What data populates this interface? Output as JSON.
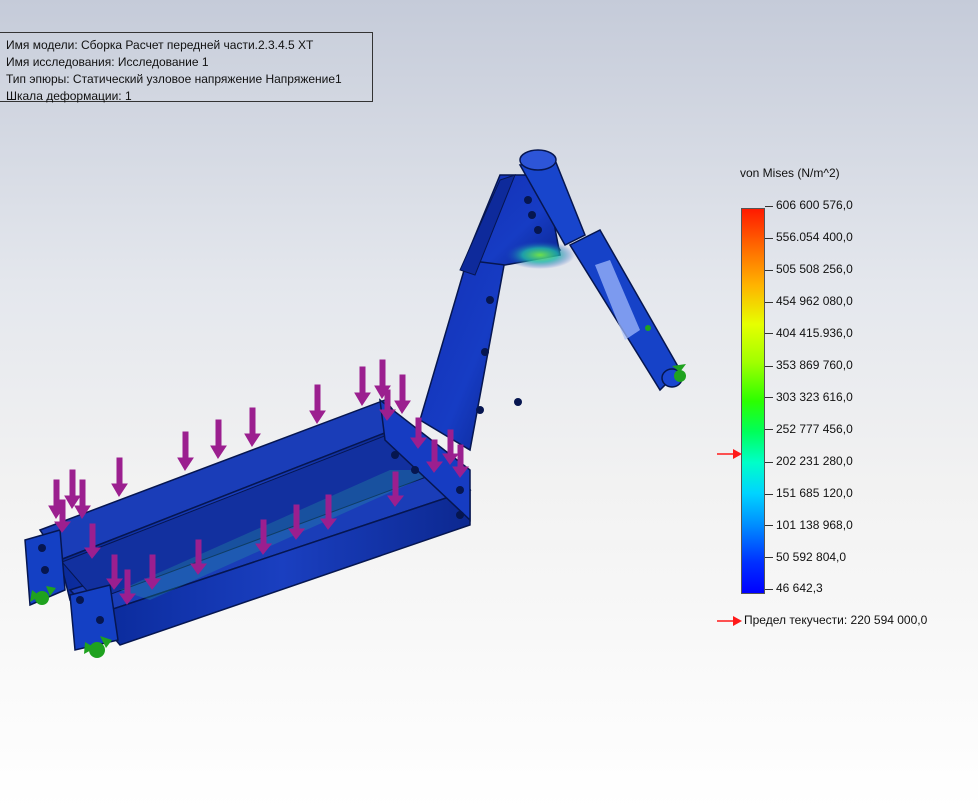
{
  "info": {
    "model_name": "Имя модели: Сборка Расчет передней части.2.3.4.5 ХТ",
    "study_name": "Имя  исследования: Исследование 1",
    "plot_type": "Тип эпюры: Статический узловое напряжение Напряжение1",
    "deformation_scale": "Шкала деформации: 1"
  },
  "legend": {
    "title": "von Mises (N/m^2)",
    "ticks": [
      "606 600 576,0",
      "556.054 400,0",
      "505 508 256,0",
      "454 962 080,0",
      "404 415.936,0",
      "353 869 760,0",
      "303 323 616,0",
      "252 777 456,0",
      "202 231 280,0",
      "151 685 120,0",
      "101 138 968,0",
      "50 592 804,0",
      "46 642,3"
    ],
    "yield_label": "Предел текучести: 220 594 000,0",
    "yield_color": "#ff1a1a"
  },
  "colors": {
    "max": "#ff1a00",
    "min": "#0000ff",
    "load_arrow": "#9b1f8f",
    "fixture": "#1fa21f"
  }
}
